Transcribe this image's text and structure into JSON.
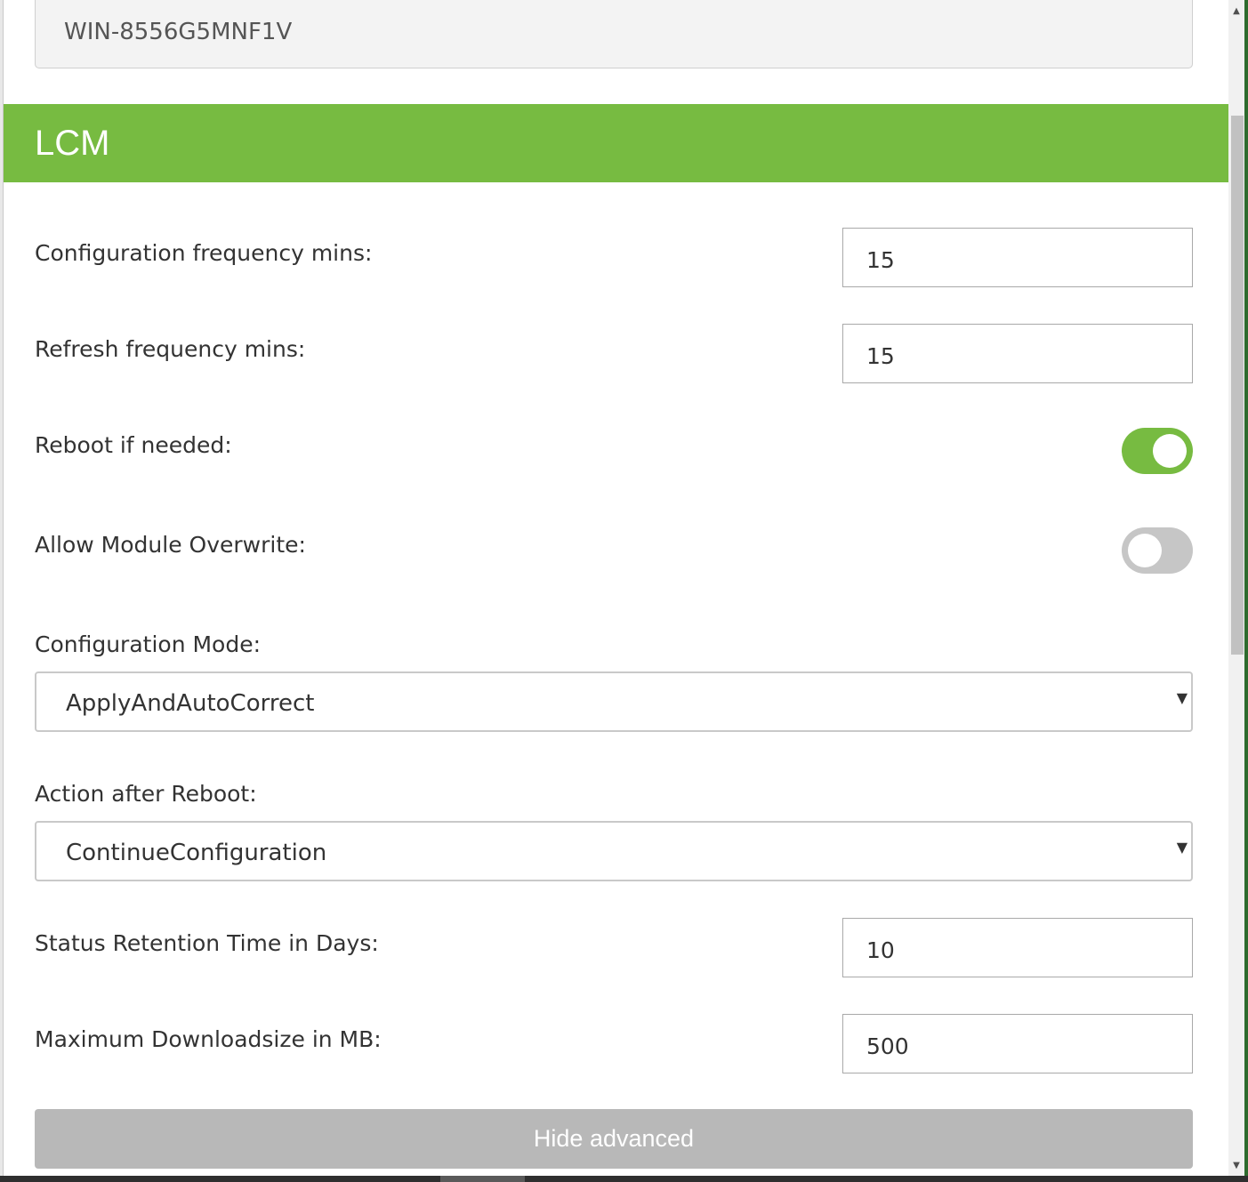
{
  "hostname": {
    "value": "WIN-8556G5MNF1V"
  },
  "section": {
    "title": "LCM"
  },
  "fields": {
    "config_frequency": {
      "label": "Configuration frequency mins:",
      "value": "15"
    },
    "refresh_frequency": {
      "label": "Refresh frequency mins:",
      "value": "15"
    },
    "reboot_if_needed": {
      "label": "Reboot if needed:",
      "enabled": true
    },
    "allow_module_overwrite": {
      "label": "Allow Module Overwrite:",
      "enabled": false
    },
    "configuration_mode": {
      "label": "Configuration Mode:",
      "selected": "ApplyAndAutoCorrect"
    },
    "action_after_reboot": {
      "label": "Action after Reboot:",
      "selected": "ContinueConfiguration"
    },
    "status_retention": {
      "label": "Status Retention Time in Days:",
      "value": "10"
    },
    "max_download": {
      "label": "Maximum Downloadsize in MB:",
      "value": "500"
    }
  },
  "buttons": {
    "hide_advanced": "Hide advanced"
  },
  "colors": {
    "accent": "#77bb41",
    "toggle_off": "#c6c6c6",
    "button_disabled": "#b8b8b8"
  },
  "icons": {
    "select_caret": "▼",
    "scroll_up": "▲",
    "scroll_down": "▼"
  }
}
